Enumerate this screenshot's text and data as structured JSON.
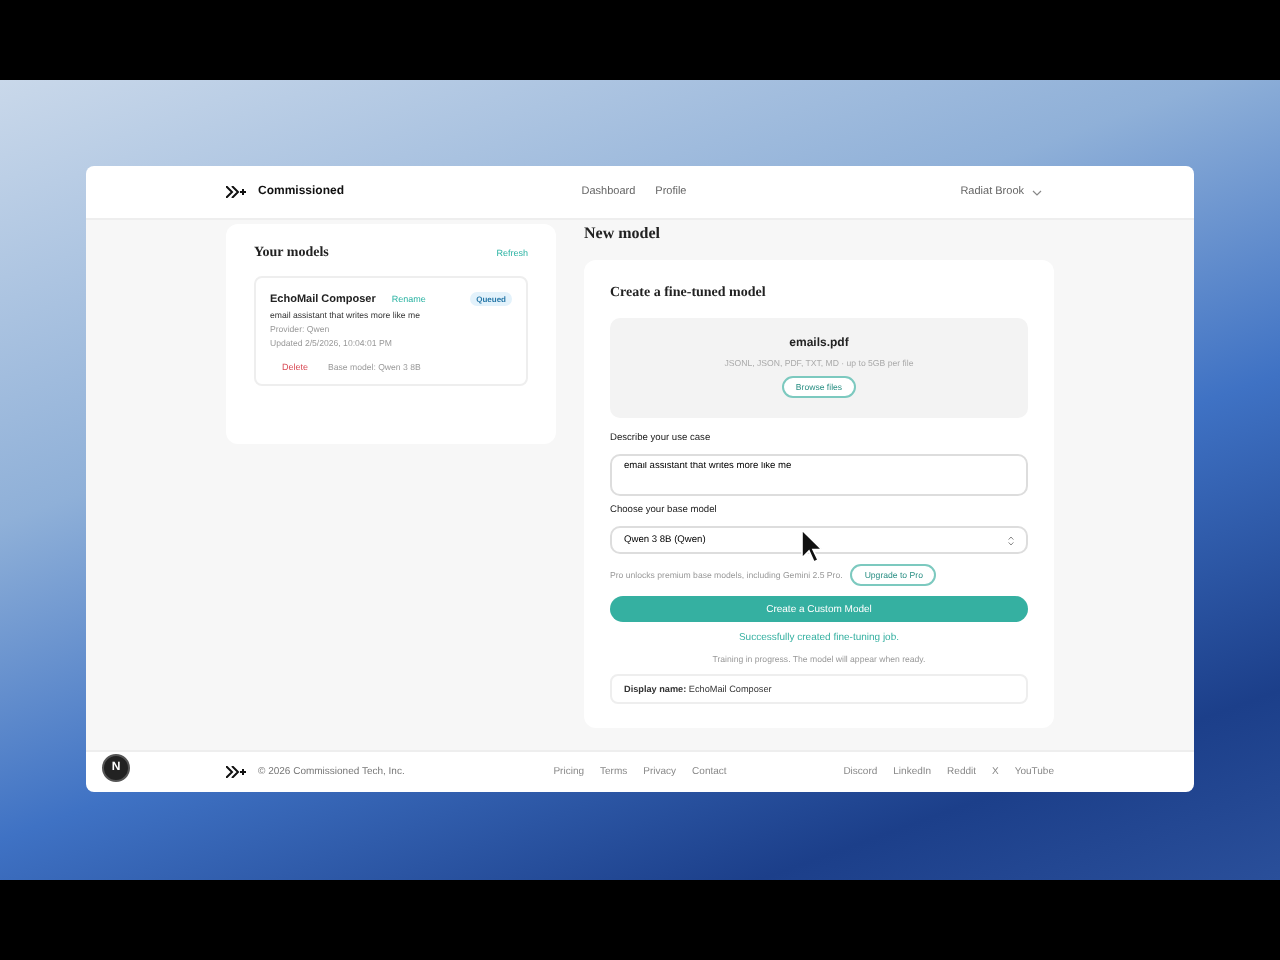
{
  "header": {
    "brand": "Commissioned",
    "nav": [
      {
        "label": "Dashboard",
        "selected": false
      },
      {
        "label": "Profile",
        "selected": false
      }
    ],
    "user": "Radiat Brook"
  },
  "models": {
    "title": "Your models",
    "refresh": "Refresh",
    "items": [
      {
        "name": "EchoMail Composer",
        "rename": "Rename",
        "status": "Queued",
        "description": "email assistant that writes more like me",
        "provider": "Provider: Qwen",
        "updated": "Updated 2/5/2026, 10:04:01 PM",
        "delete": "Delete",
        "base": "Base model: Qwen 3 8B"
      }
    ]
  },
  "new_model": {
    "heading": "New model",
    "card_title": "Create a fine-tuned model",
    "upload": {
      "file": "emails.pdf",
      "hint": "JSONL, JSON, PDF, TXT, MD · up to 5GB per file",
      "button": "Browse files"
    },
    "use_case": {
      "label": "Describe your use case",
      "value": "email assistant that writes more like me"
    },
    "base_model": {
      "label": "Choose your base model",
      "value": "Qwen 3 8B (Qwen)"
    },
    "pro_note": "Pro unlocks premium base models, including Gemini 2.5 Pro.",
    "upgrade": "Upgrade to Pro",
    "submit": "Create a Custom Model",
    "success": "Successfully created fine-tuning job.",
    "progress": "Training in progress. The model will appear when ready.",
    "result": "**Display name:** EchoMail Composer"
  },
  "footer": {
    "copyright": "© 2026 Commissioned Tech, Inc.",
    "links": [
      "Pricing",
      "Terms",
      "Privacy",
      "Contact"
    ],
    "social": [
      "Discord",
      "LinkedIn",
      "Reddit",
      "X",
      "YouTube"
    ]
  },
  "dev_badge": "N"
}
